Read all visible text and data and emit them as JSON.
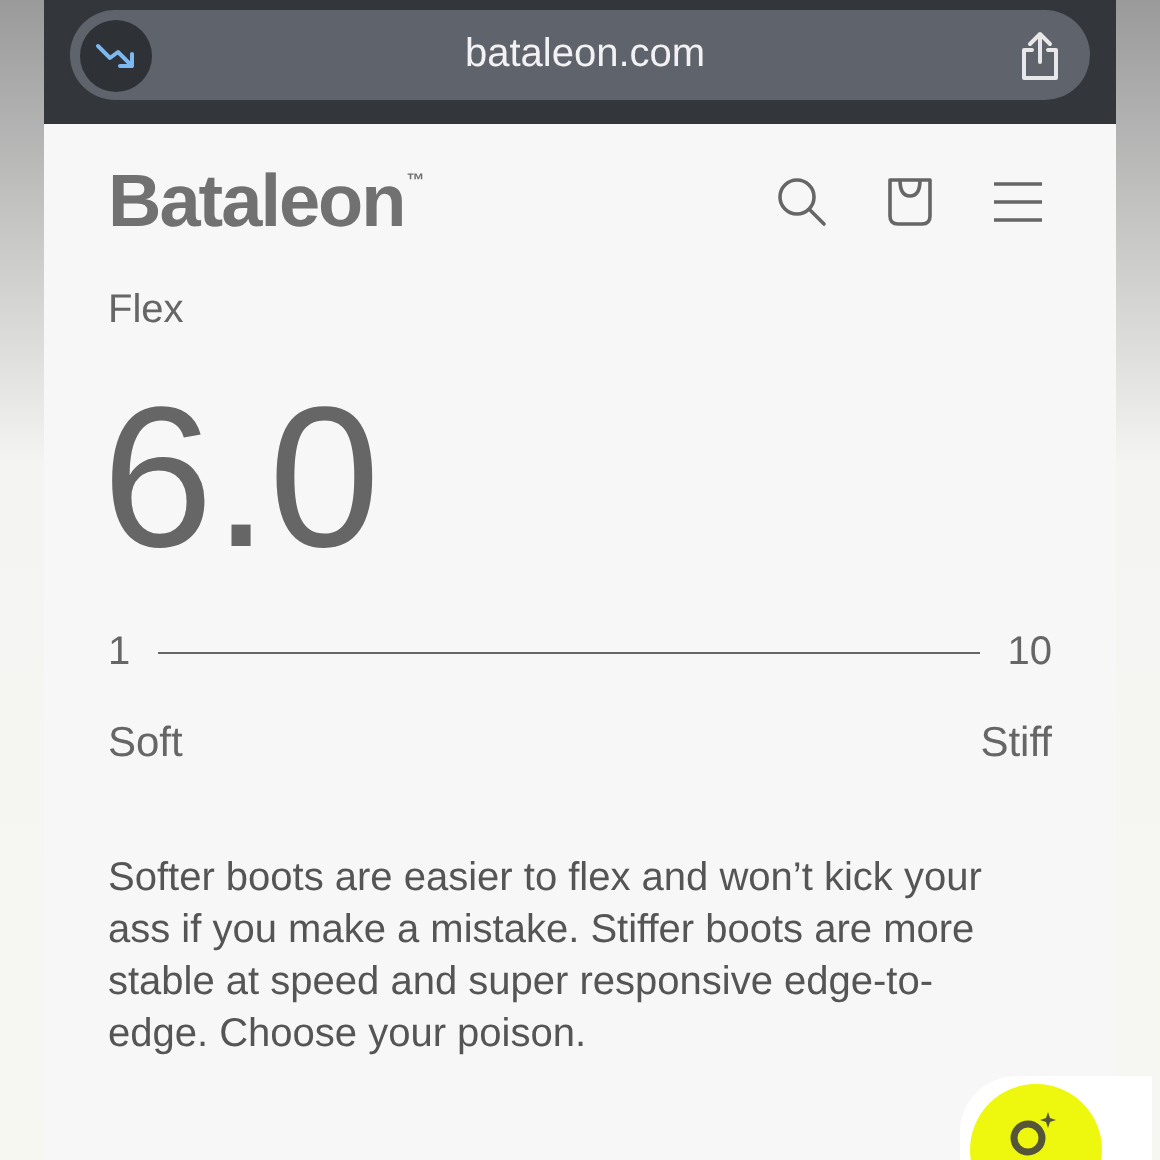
{
  "browser": {
    "url": "bataleon.com"
  },
  "header": {
    "logo": "Bataleon",
    "trademark": "™"
  },
  "spec": {
    "label": "Flex",
    "value": "6.0",
    "scale_min": "1",
    "scale_max": "10",
    "min_label": "Soft",
    "max_label": "Stiff"
  },
  "description": "Softer boots are easier to flex and won’t kick your ass if you make a mistake. Stiffer boots are more stable at speed and super responsive edge-to-edge. Choose your poison."
}
